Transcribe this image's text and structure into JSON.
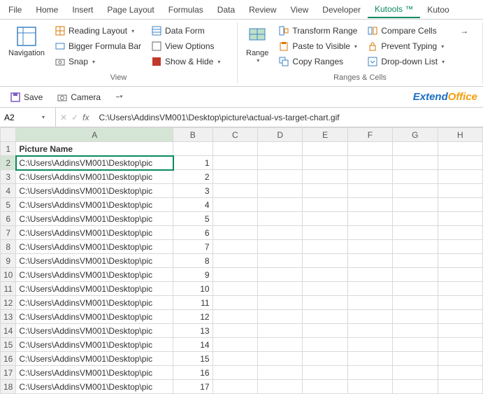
{
  "menu": [
    "File",
    "Home",
    "Insert",
    "Page Layout",
    "Formulas",
    "Data",
    "Review",
    "View",
    "Developer",
    "Kutools ™",
    "Kutoo"
  ],
  "menu_active": 9,
  "ribbon": {
    "navigation": "Navigation",
    "reading_layout": "Reading Layout",
    "bigger_formula": "Bigger Formula Bar",
    "snap": "Snap",
    "data_form": "Data Form",
    "view_options": "View Options",
    "show_hide": "Show & Hide",
    "group1_label": "View",
    "range": "Range",
    "transform_range": "Transform Range",
    "paste_visible": "Paste to Visible",
    "copy_ranges": "Copy Ranges",
    "compare_cells": "Compare Cells",
    "prevent_typing": "Prevent Typing",
    "dropdown_list": "Drop-down List",
    "group2_label": "Ranges & Cells"
  },
  "qat": {
    "save": "Save",
    "camera": "Camera"
  },
  "brand": {
    "part1": "Extend",
    "part2": "Office"
  },
  "formula": {
    "cell_ref": "A2",
    "content": "C:\\Users\\AddinsVM001\\Desktop\\picture\\actual-vs-target-chart.gif"
  },
  "columns": [
    "A",
    "B",
    "C",
    "D",
    "E",
    "F",
    "G",
    "H"
  ],
  "header_row": {
    "A": "Picture Name"
  },
  "data_rows": [
    {
      "r": 1,
      "A": "Picture Name",
      "B": ""
    },
    {
      "r": 2,
      "A": "C:\\Users\\AddinsVM001\\Desktop\\pic",
      "B": "1"
    },
    {
      "r": 3,
      "A": "C:\\Users\\AddinsVM001\\Desktop\\pic",
      "B": "2"
    },
    {
      "r": 4,
      "A": "C:\\Users\\AddinsVM001\\Desktop\\pic",
      "B": "3"
    },
    {
      "r": 5,
      "A": "C:\\Users\\AddinsVM001\\Desktop\\pic",
      "B": "4"
    },
    {
      "r": 6,
      "A": "C:\\Users\\AddinsVM001\\Desktop\\pic",
      "B": "5"
    },
    {
      "r": 7,
      "A": "C:\\Users\\AddinsVM001\\Desktop\\pic",
      "B": "6"
    },
    {
      "r": 8,
      "A": "C:\\Users\\AddinsVM001\\Desktop\\pic",
      "B": "7"
    },
    {
      "r": 9,
      "A": "C:\\Users\\AddinsVM001\\Desktop\\pic",
      "B": "8"
    },
    {
      "r": 10,
      "A": "C:\\Users\\AddinsVM001\\Desktop\\pic",
      "B": "9"
    },
    {
      "r": 11,
      "A": "C:\\Users\\AddinsVM001\\Desktop\\pic",
      "B": "10"
    },
    {
      "r": 12,
      "A": "C:\\Users\\AddinsVM001\\Desktop\\pic",
      "B": "11"
    },
    {
      "r": 13,
      "A": "C:\\Users\\AddinsVM001\\Desktop\\pic",
      "B": "12"
    },
    {
      "r": 14,
      "A": "C:\\Users\\AddinsVM001\\Desktop\\pic",
      "B": "13"
    },
    {
      "r": 15,
      "A": "C:\\Users\\AddinsVM001\\Desktop\\pic",
      "B": "14"
    },
    {
      "r": 16,
      "A": "C:\\Users\\AddinsVM001\\Desktop\\pic",
      "B": "15"
    },
    {
      "r": 17,
      "A": "C:\\Users\\AddinsVM001\\Desktop\\pic",
      "B": "16"
    },
    {
      "r": 18,
      "A": "C:\\Users\\AddinsVM001\\Desktop\\pic",
      "B": "17"
    }
  ],
  "selected_cell": "A2"
}
